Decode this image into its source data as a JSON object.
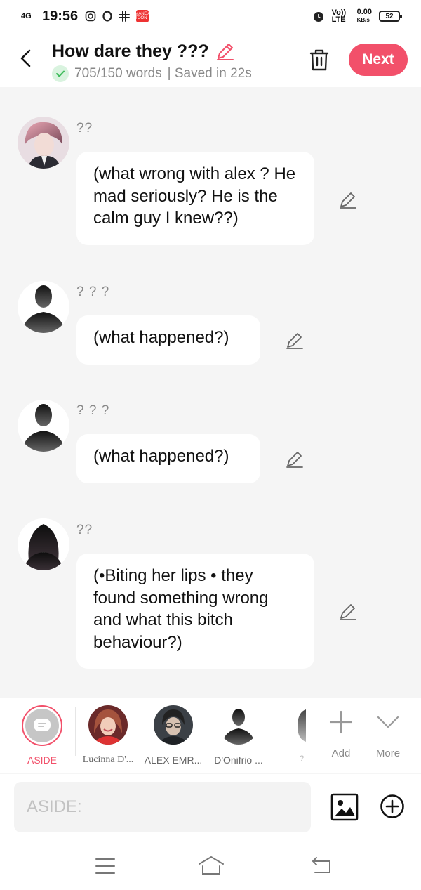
{
  "status_bar": {
    "network": "4G",
    "time": "19:56",
    "app_badge": "MANGA TOON",
    "volte": "Vo)) LTE",
    "speed": "0.00",
    "speed_unit": "KB/s",
    "battery": "52"
  },
  "header": {
    "title": "How dare they ???",
    "word_count": "705/150 words",
    "saved_status": "| Saved in 22s",
    "next_label": "Next"
  },
  "messages": [
    {
      "name": "??",
      "text": "(what wrong with alex ? He mad seriously? He is the calm guy I knew??)",
      "avatar": "red-haired-character-avatar"
    },
    {
      "name": "? ? ?",
      "text": "(what happened?)",
      "avatar": "male-silhouette-avatar"
    },
    {
      "name": "? ? ?",
      "text": "(what happened?)",
      "avatar": "male-silhouette-avatar"
    },
    {
      "name": "??",
      "text": "(•Biting her lips • they found something wrong and what this bitch behaviour?)",
      "avatar": "female-silhouette-avatar"
    }
  ],
  "characters": {
    "aside_label": "ASIDE",
    "items": [
      {
        "label": "Lucinna D'...",
        "avatar": "lucinna-avatar"
      },
      {
        "label": "ALEX EMR...",
        "avatar": "alex-avatar"
      },
      {
        "label": "D'Onifrio ...",
        "avatar": "donifrio-avatar"
      },
      {
        "label": "?",
        "avatar": "unknown-avatar"
      }
    ],
    "add_label": "Add",
    "more_label": "More"
  },
  "input": {
    "placeholder": "ASIDE:"
  },
  "colors": {
    "accent": "#f2506a",
    "background": "#f5f5f5",
    "bubble": "#ffffff"
  }
}
